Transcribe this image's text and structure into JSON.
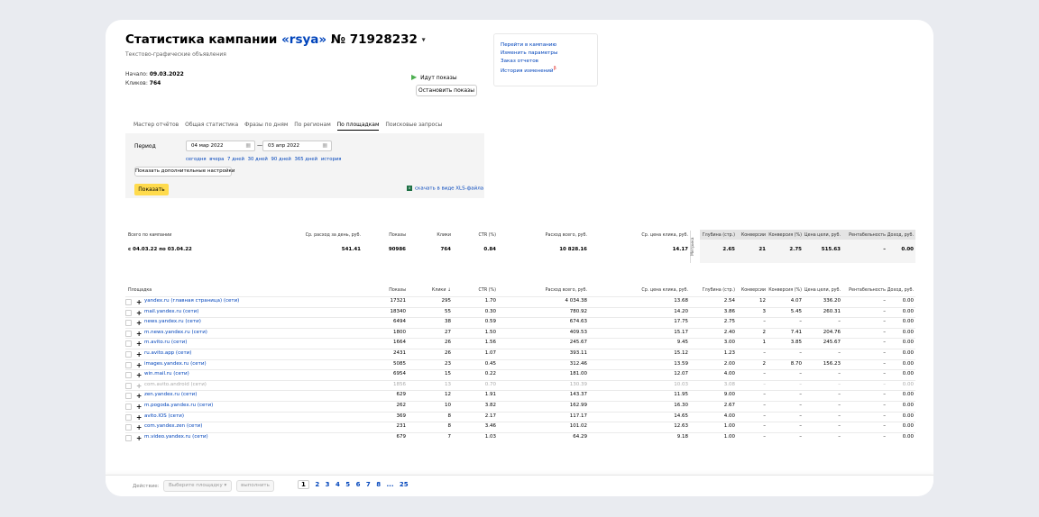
{
  "header": {
    "title_prefix": "Статистика кампании ",
    "campaign_name": "«rsya»",
    "campaign_id": " № 71928232",
    "caret": "▾",
    "subtitle": "Текстово-графические объявления",
    "start_label": "Начало:",
    "start_value": "09.03.2022",
    "clicks_label": "Кликов:",
    "clicks_value": "764"
  },
  "campaign_state": {
    "status": "Идут показы",
    "stop_button": "Остановить показы"
  },
  "right_links": [
    "Перейти в кампанию",
    "Изменить параметры",
    "Заказ отчетов",
    "История изменений"
  ],
  "history_badge": "β",
  "tabs": [
    {
      "label": "Мастер отчётов",
      "active": false
    },
    {
      "label": "Общая статистика",
      "active": false
    },
    {
      "label": "Фразы по дням",
      "active": false
    },
    {
      "label": "По регионам",
      "active": false
    },
    {
      "label": "По площадкам",
      "active": true
    },
    {
      "label": "Поисковые запросы",
      "active": false
    }
  ],
  "filter": {
    "period_label": "Период",
    "date_from": "04 мар 2022",
    "date_to": "03 апр 2022",
    "dash": "—",
    "quick_ranges": [
      "сегодня",
      "вчера",
      "7 дней",
      "30 дней",
      "90 дней",
      "365 дней",
      "история"
    ],
    "more_settings_button": "Показать дополнительные настройки",
    "show_button": "Показать",
    "xls_link": "скачать в виде XLS-файла"
  },
  "summary": {
    "headers": {
      "label": "Всего по кампании",
      "daily_spend": "Ср. расход за день, руб.",
      "impressions": "Показы",
      "clicks": "Клики",
      "ctr": "CTR (%)",
      "total_spend": "Расход всего, руб.",
      "cpc": "Ср. цена клика, руб.",
      "depth": "Глубина (стр.)",
      "conversions": "Конверсии",
      "conv_rate": "Конверсия (%)",
      "goal_cost": "Цена цели, руб.",
      "profitability": "Рентабельность",
      "revenue": "Доход, руб."
    },
    "metrika_label": "Метрика",
    "period": "с 04.03.22 по 03.04.22",
    "daily_spend": "541.41",
    "impressions": "90986",
    "clicks": "764",
    "ctr": "0.84",
    "total_spend": "10 828.16",
    "cpc": "14.17",
    "depth": "2.65",
    "conversions": "21",
    "conv_rate": "2.75",
    "goal_cost": "515.63",
    "profitability": "–",
    "revenue": "0.00"
  },
  "table": {
    "columns": {
      "site": "Площадка",
      "impressions": "Показы",
      "clicks": "Клики ↓",
      "ctr": "CTR (%)",
      "total_spend": "Расход всего, руб.",
      "cpc": "Ср. цена клика, руб.",
      "depth": "Глубина (стр.)",
      "conversions": "Конверсии",
      "conv_rate": "Конверсия (%)",
      "goal_cost": "Цена цели, руб.",
      "profitability": "Рентабельность",
      "revenue": "Доход, руб."
    },
    "rows": [
      {
        "site": "yandex.ru (главная страница) (сети)",
        "impressions": "17321",
        "clicks": "295",
        "ctr": "1.70",
        "spend": "4 034.38",
        "cpc": "13.68",
        "depth": "2.54",
        "conv": "12",
        "conv_rate": "4.07",
        "goal_cost": "336.20",
        "profit": "–",
        "revenue": "0.00",
        "disabled": false
      },
      {
        "site": "mail.yandex.ru (сети)",
        "impressions": "18340",
        "clicks": "55",
        "ctr": "0.30",
        "spend": "780.92",
        "cpc": "14.20",
        "depth": "3.86",
        "conv": "3",
        "conv_rate": "5.45",
        "goal_cost": "260.31",
        "profit": "–",
        "revenue": "0.00",
        "disabled": false
      },
      {
        "site": "news.yandex.ru (сети)",
        "impressions": "6494",
        "clicks": "38",
        "ctr": "0.59",
        "spend": "674.63",
        "cpc": "17.75",
        "depth": "2.75",
        "conv": "–",
        "conv_rate": "–",
        "goal_cost": "–",
        "profit": "–",
        "revenue": "0.00",
        "disabled": false
      },
      {
        "site": "m.news.yandex.ru (сети)",
        "impressions": "1800",
        "clicks": "27",
        "ctr": "1.50",
        "spend": "409.53",
        "cpc": "15.17",
        "depth": "2.40",
        "conv": "2",
        "conv_rate": "7.41",
        "goal_cost": "204.76",
        "profit": "–",
        "revenue": "0.00",
        "disabled": false
      },
      {
        "site": "m.avito.ru (сети)",
        "impressions": "1664",
        "clicks": "26",
        "ctr": "1.56",
        "spend": "245.67",
        "cpc": "9.45",
        "depth": "3.00",
        "conv": "1",
        "conv_rate": "3.85",
        "goal_cost": "245.67",
        "profit": "–",
        "revenue": "0.00",
        "disabled": false
      },
      {
        "site": "ru.avito.app (сети)",
        "impressions": "2431",
        "clicks": "26",
        "ctr": "1.07",
        "spend": "393.11",
        "cpc": "15.12",
        "depth": "1.23",
        "conv": "–",
        "conv_rate": "–",
        "goal_cost": "–",
        "profit": "–",
        "revenue": "0.00",
        "disabled": false
      },
      {
        "site": "images.yandex.ru (сети)",
        "impressions": "5085",
        "clicks": "23",
        "ctr": "0.45",
        "spend": "312.46",
        "cpc": "13.59",
        "depth": "2.00",
        "conv": "2",
        "conv_rate": "8.70",
        "goal_cost": "156.23",
        "profit": "–",
        "revenue": "0.00",
        "disabled": false
      },
      {
        "site": "win.mail.ru (сети)",
        "impressions": "6954",
        "clicks": "15",
        "ctr": "0.22",
        "spend": "181.00",
        "cpc": "12.07",
        "depth": "4.00",
        "conv": "–",
        "conv_rate": "–",
        "goal_cost": "–",
        "profit": "–",
        "revenue": "0.00",
        "disabled": false
      },
      {
        "site": "com.avito.android (сети)",
        "impressions": "1856",
        "clicks": "13",
        "ctr": "0.70",
        "spend": "130.39",
        "cpc": "10.03",
        "depth": "3.08",
        "conv": "–",
        "conv_rate": "–",
        "goal_cost": "–",
        "profit": "–",
        "revenue": "0.00",
        "disabled": true
      },
      {
        "site": "zen.yandex.ru (сети)",
        "impressions": "629",
        "clicks": "12",
        "ctr": "1.91",
        "spend": "143.37",
        "cpc": "11.95",
        "depth": "9.00",
        "conv": "–",
        "conv_rate": "–",
        "goal_cost": "–",
        "profit": "–",
        "revenue": "0.00",
        "disabled": false
      },
      {
        "site": "m.pogoda.yandex.ru (сети)",
        "impressions": "262",
        "clicks": "10",
        "ctr": "3.82",
        "spend": "162.99",
        "cpc": "16.30",
        "depth": "2.67",
        "conv": "–",
        "conv_rate": "–",
        "goal_cost": "–",
        "profit": "–",
        "revenue": "0.00",
        "disabled": false
      },
      {
        "site": "avito.IOS (сети)",
        "impressions": "369",
        "clicks": "8",
        "ctr": "2.17",
        "spend": "117.17",
        "cpc": "14.65",
        "depth": "4.00",
        "conv": "–",
        "conv_rate": "–",
        "goal_cost": "–",
        "profit": "–",
        "revenue": "0.00",
        "disabled": false
      },
      {
        "site": "com.yandex.zen (сети)",
        "impressions": "231",
        "clicks": "8",
        "ctr": "3.46",
        "spend": "101.02",
        "cpc": "12.63",
        "depth": "1.00",
        "conv": "–",
        "conv_rate": "–",
        "goal_cost": "–",
        "profit": "–",
        "revenue": "0.00",
        "disabled": false
      },
      {
        "site": "m.video.yandex.ru (сети)",
        "impressions": "679",
        "clicks": "7",
        "ctr": "1.03",
        "spend": "64.29",
        "cpc": "9.18",
        "depth": "1.00",
        "conv": "–",
        "conv_rate": "–",
        "goal_cost": "–",
        "profit": "–",
        "revenue": "0.00",
        "disabled": false
      }
    ]
  },
  "bottom_bar": {
    "action_label": "Действие:",
    "select_placeholder": "Выберите площадку",
    "select_caret": "▾",
    "execute_button": "выполнить",
    "pages": [
      "1",
      "2",
      "3",
      "4",
      "5",
      "6",
      "7",
      "8",
      "...",
      "25"
    ],
    "current_page": "1"
  },
  "icons": {
    "play": "play-icon",
    "calendar": "calendar-icon",
    "xls": "xls-file-icon",
    "plus": "plus-icon"
  },
  "colors": {
    "link": "#0044bb",
    "show_button": "#ffdb4d",
    "status_green": "#4caf50",
    "xls_green": "#1d7044"
  }
}
